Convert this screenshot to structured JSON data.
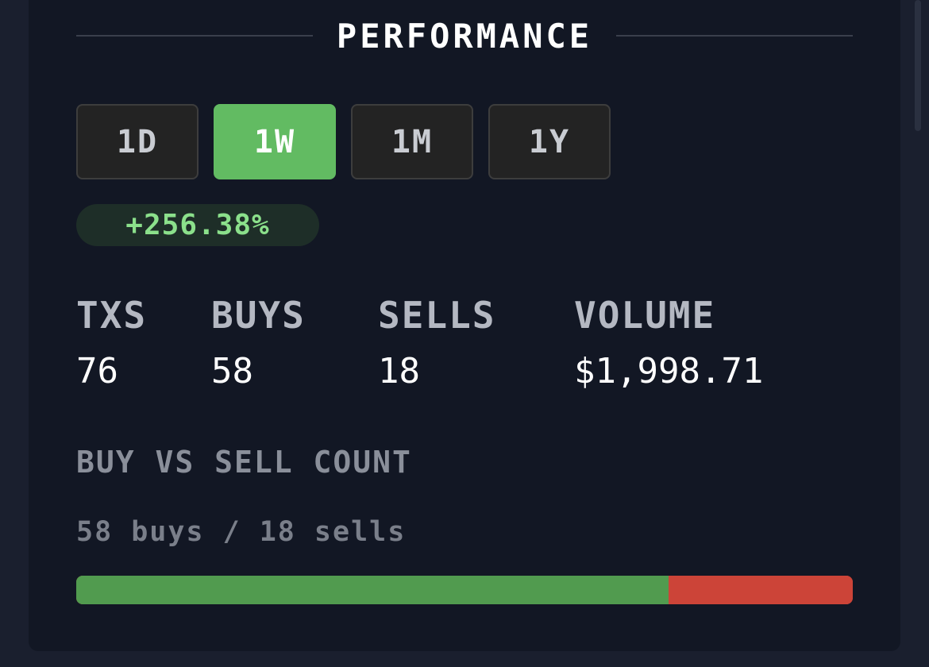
{
  "header": {
    "title": "PERFORMANCE"
  },
  "tabs": [
    {
      "label": "1D",
      "active": false
    },
    {
      "label": "1W",
      "active": true
    },
    {
      "label": "1M",
      "active": false
    },
    {
      "label": "1Y",
      "active": false
    }
  ],
  "change": {
    "value": "+256.38%",
    "color": "#8be08b"
  },
  "stats": {
    "txs": {
      "label": "TXS",
      "value": "76"
    },
    "buys": {
      "label": "BUYS",
      "value": "58"
    },
    "sells": {
      "label": "SELLS",
      "value": "18"
    },
    "volume": {
      "label": "VOLUME",
      "value": "$1,998.71"
    }
  },
  "buy_vs_sell": {
    "title": "BUY VS SELL COUNT",
    "summary": "58 buys / 18 sells",
    "buys": 58,
    "sells": 18,
    "buy_color": "#519b4f",
    "sell_color": "#cc4438"
  },
  "colors": {
    "accent": "#62bb62",
    "background": "#121724"
  }
}
